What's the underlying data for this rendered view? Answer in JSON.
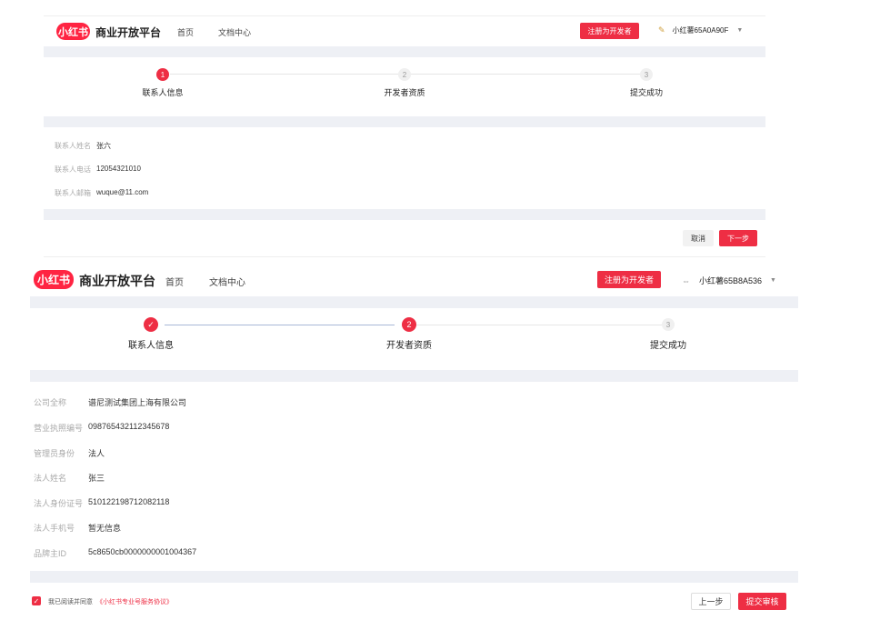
{
  "top": {
    "logo_text": "小红书",
    "platform_title": "商业开放平台",
    "nav": [
      "首页",
      "文档中心"
    ],
    "register_label": "注册为开发者",
    "username": "小红薯65A0A90F",
    "steps": [
      {
        "num": "1",
        "label": "联系人信息",
        "state": "active"
      },
      {
        "num": "2",
        "label": "开发者资质",
        "state": "todo"
      },
      {
        "num": "3",
        "label": "提交成功",
        "state": "todo"
      }
    ],
    "fields": [
      {
        "label": "联系人姓名",
        "value": "张六"
      },
      {
        "label": "联系人电话",
        "value": "12054321010"
      },
      {
        "label": "联系人邮箱",
        "value": "wuque@11.com"
      }
    ],
    "cancel_label": "取消",
    "next_label": "下一步"
  },
  "bottom": {
    "logo_text": "小红书",
    "platform_title": "商业开放平台",
    "nav": [
      "首页",
      "文档中心"
    ],
    "register_label": "注册为开发者",
    "username": "小红薯65B8A536",
    "steps": [
      {
        "num": "✓",
        "label": "联系人信息",
        "state": "done"
      },
      {
        "num": "2",
        "label": "开发者资质",
        "state": "active"
      },
      {
        "num": "3",
        "label": "提交成功",
        "state": "todo"
      }
    ],
    "fields": [
      {
        "label": "公司全称",
        "value": "谱尼测试集团上海有限公司"
      },
      {
        "label": "营业执照编号",
        "value": "098765432112345678"
      },
      {
        "label": "管理员身份",
        "value": "法人"
      },
      {
        "label": "法人姓名",
        "value": "张三"
      },
      {
        "label": "法人身份证号",
        "value": "510122198712082118"
      },
      {
        "label": "法人手机号",
        "value": "暂无信息"
      },
      {
        "label": "品牌主ID",
        "value": "5c8650cb0000000001004367"
      }
    ],
    "agree_text": "我已阅读并同意",
    "agree_link": "《小红书专业号服务协议》",
    "prev_label": "上一步",
    "submit_label": "提交审核"
  },
  "colors": {
    "brand": "#ff2442",
    "accent_red": "#ee2e44",
    "band": "#eef0f5",
    "done_line": "#a8b8d8"
  }
}
